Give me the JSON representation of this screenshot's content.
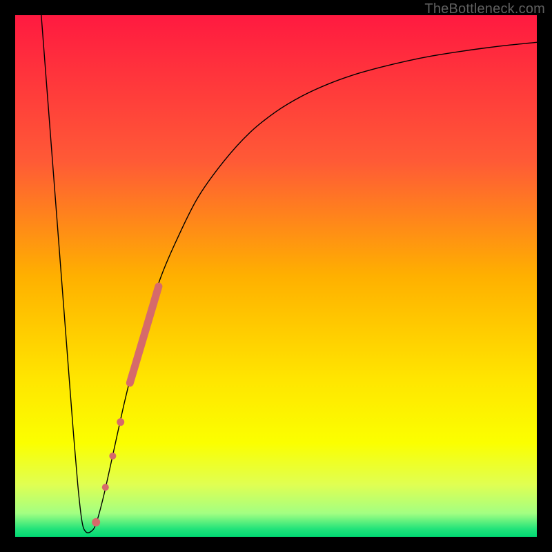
{
  "watermark": "TheBottleneck.com",
  "chart_data": {
    "type": "line",
    "title": "",
    "xlabel": "",
    "ylabel": "",
    "xlim": [
      0,
      100
    ],
    "ylim": [
      0,
      100
    ],
    "background_gradient": {
      "stops": [
        {
          "offset": 0.0,
          "color": "#ff1a40"
        },
        {
          "offset": 0.28,
          "color": "#ff5a36"
        },
        {
          "offset": 0.5,
          "color": "#ffb000"
        },
        {
          "offset": 0.7,
          "color": "#ffe600"
        },
        {
          "offset": 0.82,
          "color": "#fbff00"
        },
        {
          "offset": 0.9,
          "color": "#e0ff52"
        },
        {
          "offset": 0.955,
          "color": "#a3ff82"
        },
        {
          "offset": 0.985,
          "color": "#22e37a"
        },
        {
          "offset": 1.0,
          "color": "#00d973"
        }
      ]
    },
    "series": [
      {
        "name": "bottleneck-curve",
        "stroke": "#000000",
        "stroke_width": 1.4,
        "points": [
          {
            "x": 5.0,
            "y": 100.0
          },
          {
            "x": 6.0,
            "y": 87.0
          },
          {
            "x": 7.0,
            "y": 74.0
          },
          {
            "x": 8.0,
            "y": 61.0
          },
          {
            "x": 9.0,
            "y": 48.0
          },
          {
            "x": 10.0,
            "y": 35.0
          },
          {
            "x": 11.0,
            "y": 22.0
          },
          {
            "x": 12.0,
            "y": 10.0
          },
          {
            "x": 12.8,
            "y": 3.0
          },
          {
            "x": 13.5,
            "y": 1.0
          },
          {
            "x": 14.5,
            "y": 1.0
          },
          {
            "x": 15.5,
            "y": 2.5
          },
          {
            "x": 17.0,
            "y": 8.0
          },
          {
            "x": 19.0,
            "y": 17.0
          },
          {
            "x": 21.0,
            "y": 26.0
          },
          {
            "x": 23.0,
            "y": 34.0
          },
          {
            "x": 25.0,
            "y": 41.0
          },
          {
            "x": 28.0,
            "y": 50.0
          },
          {
            "x": 31.0,
            "y": 57.0
          },
          {
            "x": 35.0,
            "y": 65.0
          },
          {
            "x": 40.0,
            "y": 72.0
          },
          {
            "x": 45.0,
            "y": 77.5
          },
          {
            "x": 50.0,
            "y": 81.5
          },
          {
            "x": 55.0,
            "y": 84.5
          },
          {
            "x": 60.0,
            "y": 86.8
          },
          {
            "x": 65.0,
            "y": 88.6
          },
          {
            "x": 70.0,
            "y": 90.0
          },
          {
            "x": 75.0,
            "y": 91.2
          },
          {
            "x": 80.0,
            "y": 92.2
          },
          {
            "x": 85.0,
            "y": 93.0
          },
          {
            "x": 90.0,
            "y": 93.7
          },
          {
            "x": 95.0,
            "y": 94.3
          },
          {
            "x": 100.0,
            "y": 94.8
          }
        ]
      }
    ],
    "markers": {
      "color": "#d66a6a",
      "segment": {
        "x1": 22.0,
        "y1": 29.5,
        "x2": 27.5,
        "y2": 48.0,
        "width": 11
      },
      "dots": [
        {
          "x": 20.2,
          "y": 22.0,
          "r": 5.5
        },
        {
          "x": 18.7,
          "y": 15.5,
          "r": 5.0
        },
        {
          "x": 17.3,
          "y": 9.5,
          "r": 5.0
        },
        {
          "x": 15.5,
          "y": 2.8,
          "r": 6.0
        }
      ]
    }
  }
}
